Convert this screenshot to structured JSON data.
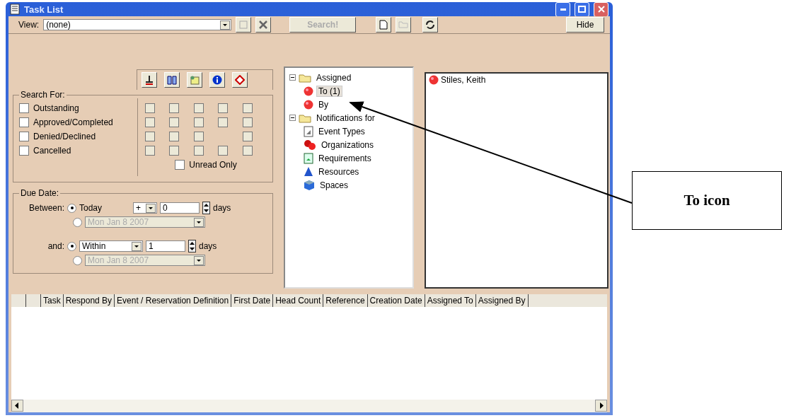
{
  "window": {
    "title": "Task List"
  },
  "toolbar": {
    "view_label": "View:",
    "view_value": "(none)",
    "search_button": {
      "label": "Search!",
      "disabled": true
    },
    "hide_button": {
      "label": "Hide"
    }
  },
  "search_for": {
    "legend": "Search For:",
    "statuses": [
      {
        "label": "Outstanding",
        "checked": false
      },
      {
        "label": "Approved/Completed",
        "checked": false
      },
      {
        "label": "Denied/Declined",
        "checked": false
      },
      {
        "label": "Cancelled",
        "checked": false
      }
    ],
    "grid": [
      [
        {
          "kind": "checkbox",
          "checked": false
        },
        {
          "kind": "checkbox",
          "checked": false
        },
        {
          "kind": "checkbox",
          "checked": false
        },
        {
          "kind": "checkbox",
          "checked": false
        },
        {
          "kind": "checkbox",
          "checked": false
        }
      ],
      [
        {
          "kind": "checkbox",
          "checked": false
        },
        {
          "kind": "checkbox",
          "checked": false
        },
        {
          "kind": "checkbox",
          "checked": false
        },
        {
          "kind": "checkbox",
          "checked": false
        },
        {
          "kind": "checkbox",
          "checked": false
        }
      ],
      [
        {
          "kind": "checkbox",
          "checked": false
        },
        {
          "kind": "checkbox",
          "checked": false
        },
        {
          "kind": "checkbox",
          "checked": false
        },
        {
          "kind": "blank"
        },
        {
          "kind": "checkbox",
          "checked": false
        }
      ],
      [
        {
          "kind": "checkbox",
          "checked": false
        },
        {
          "kind": "checkbox",
          "checked": false
        },
        {
          "kind": "checkbox",
          "checked": false
        },
        {
          "kind": "checkbox",
          "checked": false
        },
        {
          "kind": "checkbox",
          "checked": false
        }
      ]
    ],
    "unread_only": {
      "label": "Unread Only",
      "checked": false
    }
  },
  "due_date": {
    "legend": "Due Date:",
    "rows": [
      {
        "label": "Between:",
        "option": {
          "selected": true,
          "kind": "text",
          "text": "Today"
        },
        "sign": "+",
        "number": "0",
        "unit": "days",
        "date_option": {
          "selected": false,
          "date": "Mon Jan  8  2007"
        }
      },
      {
        "label": "and:",
        "option": {
          "selected": true,
          "kind": "dropdown",
          "text": "Within"
        },
        "number": "1",
        "unit": "days",
        "date_option": {
          "selected": false,
          "date": "Mon Jan  8  2007"
        }
      }
    ]
  },
  "tree": [
    {
      "label": "Assigned",
      "kind": "folder",
      "expanded": true,
      "selected": false,
      "children": [
        {
          "label": "To (1)",
          "kind": "ball",
          "selected": true
        },
        {
          "label": "By",
          "kind": "ball",
          "selected": false
        }
      ]
    },
    {
      "label": "Notifications for",
      "kind": "folder",
      "expanded": true,
      "selected": false,
      "children": [
        {
          "label": "Event Types",
          "kind": "page",
          "selected": false
        },
        {
          "label": "Organizations",
          "kind": "balls",
          "selected": false
        },
        {
          "label": "Requirements",
          "kind": "form",
          "selected": false
        },
        {
          "label": "Resources",
          "kind": "cone",
          "selected": false
        },
        {
          "label": "Spaces",
          "kind": "cube",
          "selected": false
        }
      ]
    }
  ],
  "list": [
    {
      "label": "Stiles, Keith"
    }
  ],
  "table": {
    "columns": [
      "Task",
      "Respond By",
      "Event / Reservation Definition",
      "First Date",
      "Head Count",
      "Reference",
      "Creation Date",
      "Assigned To",
      "Assigned By"
    ]
  },
  "callout": {
    "text": "To icon"
  }
}
